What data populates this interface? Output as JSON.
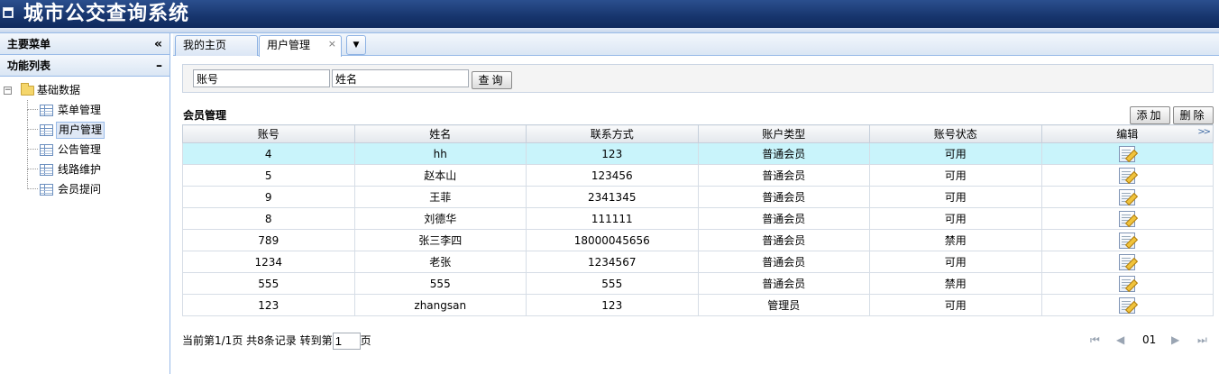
{
  "app": {
    "title": "城市公交查询系统"
  },
  "sidebar": {
    "menu_title": "主要菜单",
    "collapse_glyph": "«",
    "func_title": "功能列表",
    "func_glyph": "–",
    "root": {
      "toggle": "−",
      "label": "基础数据"
    },
    "items": [
      {
        "label": "菜单管理"
      },
      {
        "label": "用户管理"
      },
      {
        "label": "公告管理"
      },
      {
        "label": "线路维护"
      },
      {
        "label": "会员提问"
      }
    ]
  },
  "tabs": [
    {
      "label": "我的主页"
    },
    {
      "label": "用户管理",
      "close": "×"
    }
  ],
  "tab_menu_glyph": "▼",
  "search": {
    "account_value": "账号",
    "name_value": "姓名",
    "query_label": "查询"
  },
  "grid": {
    "title": "会员管理",
    "add_label": "添加",
    "delete_label": "删除",
    "columns": [
      "账号",
      "姓名",
      "联系方式",
      "账户类型",
      "账号状态",
      "编辑"
    ],
    "expander_glyph": ">>",
    "rows": [
      [
        "4",
        "hh",
        "123",
        "普通会员",
        "可用"
      ],
      [
        "5",
        "赵本山",
        "123456",
        "普通会员",
        "可用"
      ],
      [
        "9",
        "王菲",
        "2341345",
        "普通会员",
        "可用"
      ],
      [
        "8",
        "刘德华",
        "111111",
        "普通会员",
        "可用"
      ],
      [
        "789",
        "张三李四",
        "18000045656",
        "普通会员",
        "禁用"
      ],
      [
        "1234",
        "老张",
        "1234567",
        "普通会员",
        "可用"
      ],
      [
        "555",
        "555",
        "555",
        "普通会员",
        "禁用"
      ],
      [
        "123",
        "zhangsan",
        "123",
        "管理员",
        "可用"
      ]
    ],
    "highlight_color": "#c9f4fb"
  },
  "pager": {
    "summary": "当前第1/1页 共8条记录 转到第",
    "page_input": "1",
    "suffix": "页",
    "first": "⏮",
    "prev": "◀",
    "current": "01",
    "next": "▶",
    "last": "⏭"
  },
  "colors": {
    "banner": "#17356d",
    "border": "#99bbe8"
  }
}
